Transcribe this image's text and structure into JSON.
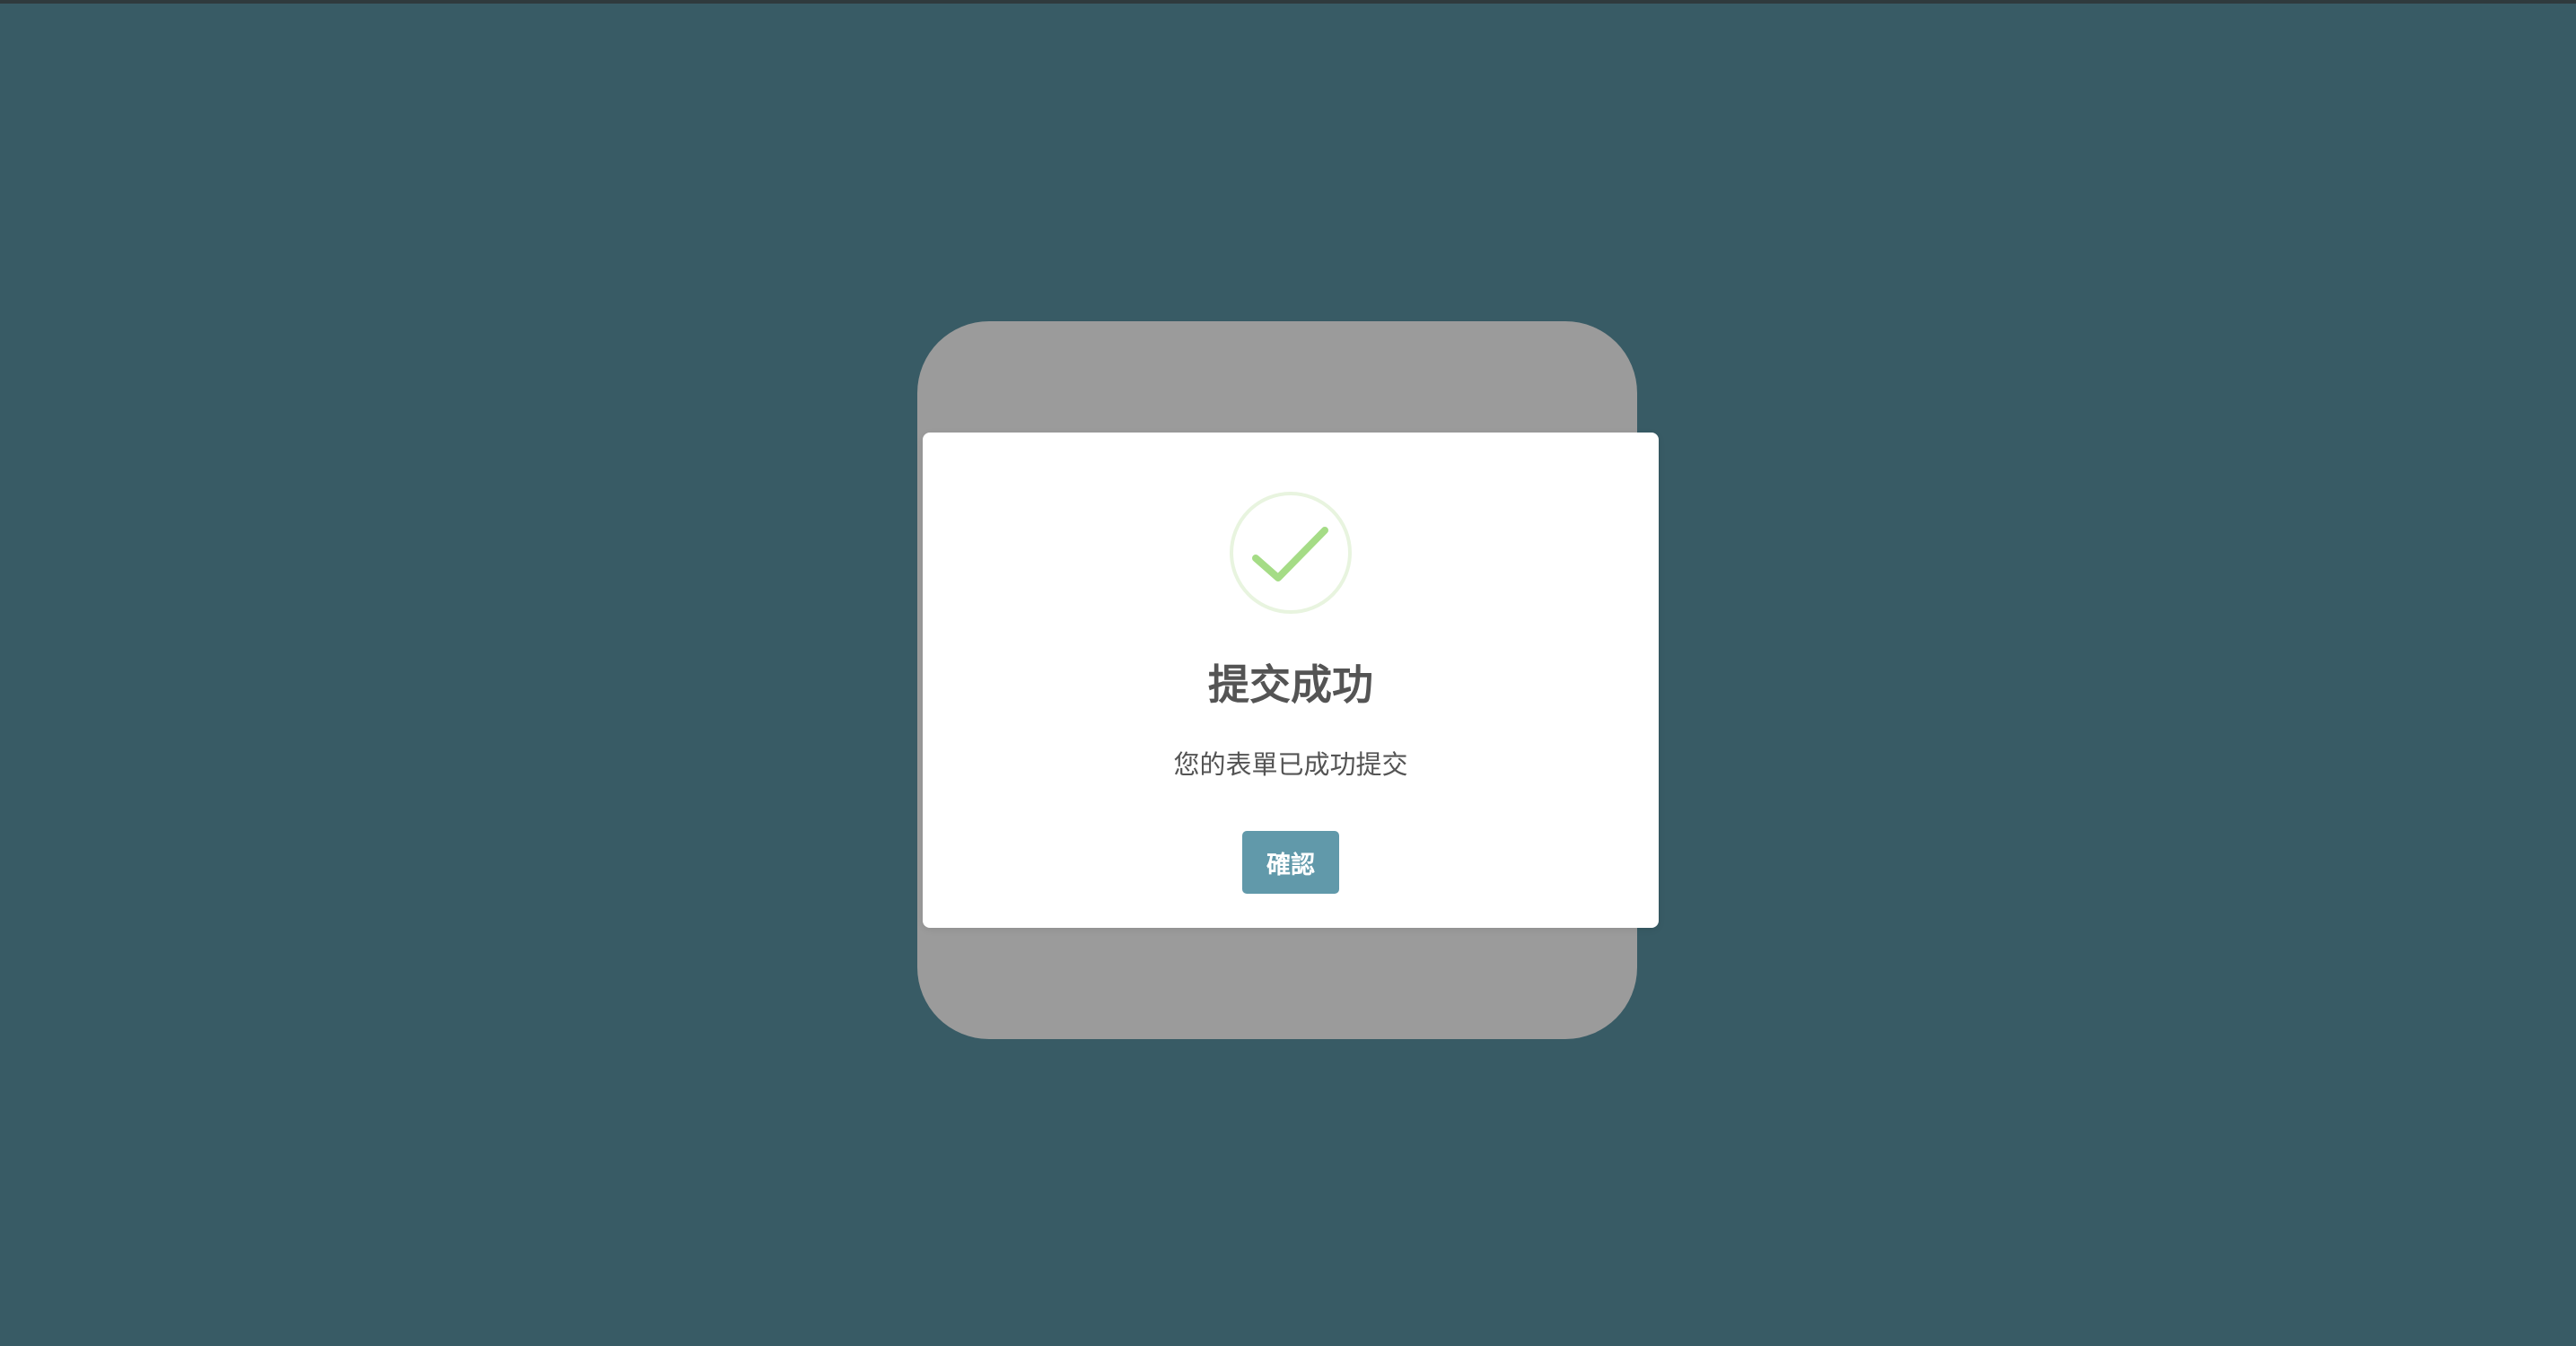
{
  "dialog": {
    "icon": "success-check-icon",
    "title": "提交成功",
    "message": "您的表單已成功提交",
    "confirm_label": "確認"
  },
  "colors": {
    "page_background": "#385b65",
    "backdrop_card": "#9b9b9b",
    "dialog_background": "#ffffff",
    "success_ring": "#e8f4df",
    "success_check": "#a5dc86",
    "text": "#545454",
    "button_background": "#6199aa",
    "button_text": "#ffffff"
  }
}
